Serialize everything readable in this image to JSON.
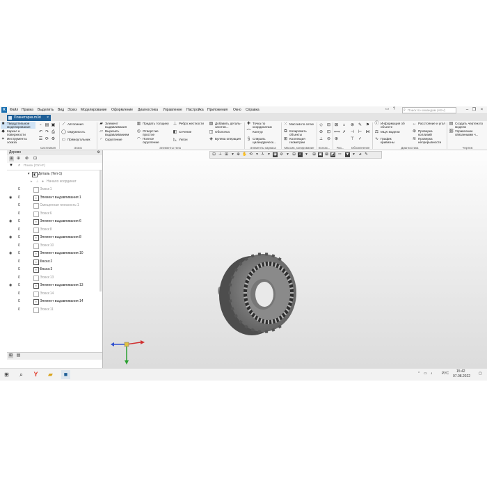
{
  "menu": {
    "items": [
      "Файл",
      "Правка",
      "Выделить",
      "Вид",
      "Эскиз",
      "Моделирование",
      "Оформление",
      "Диагностика",
      "Управление",
      "Настройка",
      "Приложения",
      "Окно",
      "Справка"
    ],
    "search_placeholder": "Поиск по командам (Alt+/)"
  },
  "tab": {
    "label": "Планетарка.m3d"
  },
  "ribbon": {
    "left_tabs": [
      "Твердотельное моделирование",
      "Каркас и поверхности",
      "Инструменты эскиза"
    ],
    "sketch": [
      "Автолиния",
      "Окружность",
      "Прямоугольник"
    ],
    "elements": [
      "Элемент выдавливания",
      "Вырезать выдавливанием",
      "Скругление"
    ],
    "elements2": [
      "Придать толщину",
      "Отверстие простое",
      "Полное скругление"
    ],
    "elements3": [
      "Ребро жесткости",
      "Сечение",
      "Уклон"
    ],
    "elements4": [
      "Добавить деталь-заготов...",
      "Оболочка",
      "Булева операция"
    ],
    "frame": [
      "Точка по координатам",
      "Контур",
      "Спираль цилиндрическ..."
    ],
    "arrays": [
      "Массив по сетке",
      "Копировать объекты",
      "Коллекция геометрии"
    ],
    "diag": [
      "Информация об объекте",
      "МЦХ модели",
      "График кривизны"
    ],
    "diag2": [
      "Расстояние и угол",
      "Проверка коллизий",
      "Проверка непрерывности"
    ],
    "drawings": [
      "Создать чертеж по модели",
      "Управление связанными ч..."
    ],
    "groups": [
      "Системная",
      "Эскиз",
      "Элементы тела",
      "Элементы каркаса",
      "Массив, копирование",
      "Вспом...",
      "Раз...",
      "Обозначения",
      "Диагностика",
      "Чертеж"
    ]
  },
  "tree": {
    "title": "Дерево",
    "search_placeholder": "Поиск (Ctrl+F)",
    "root": "Деталь (Тел-1)",
    "origin": "Начало координат",
    "items": [
      {
        "name": "Эскиз:1",
        "visible": false,
        "dim": true
      },
      {
        "name": "Элемент выдавливания:1",
        "visible": true,
        "dim": false
      },
      {
        "name": "Смещенная плоскость:1",
        "visible": false,
        "dim": true
      },
      {
        "name": "Эскиз:6",
        "visible": false,
        "dim": true
      },
      {
        "name": "Элемент выдавливания:6",
        "visible": true,
        "dim": false
      },
      {
        "name": "Эскиз:8",
        "visible": false,
        "dim": true
      },
      {
        "name": "Элемент выдавливания:8",
        "visible": true,
        "dim": false
      },
      {
        "name": "Эскиз:10",
        "visible": false,
        "dim": true
      },
      {
        "name": "Элемент выдавливания:10",
        "visible": true,
        "dim": false
      },
      {
        "name": "Фаска:2",
        "visible": false,
        "dim": false
      },
      {
        "name": "Фаска:3",
        "visible": false,
        "dim": false
      },
      {
        "name": "Эскиз:13",
        "visible": false,
        "dim": true
      },
      {
        "name": "Элемент выдавливания:13",
        "visible": true,
        "dim": false
      },
      {
        "name": "Эскиз:14",
        "visible": false,
        "dim": true
      },
      {
        "name": "Элемент выдавливания:14",
        "visible": false,
        "dim": false
      },
      {
        "name": "Эскиз:11",
        "visible": false,
        "dim": true
      }
    ]
  },
  "taskbar": {
    "language": "РУС",
    "time": "15:42",
    "date": "07.08.2022"
  },
  "colors": {
    "accent": "#1f5f96",
    "gear": "#6d6d6d"
  }
}
